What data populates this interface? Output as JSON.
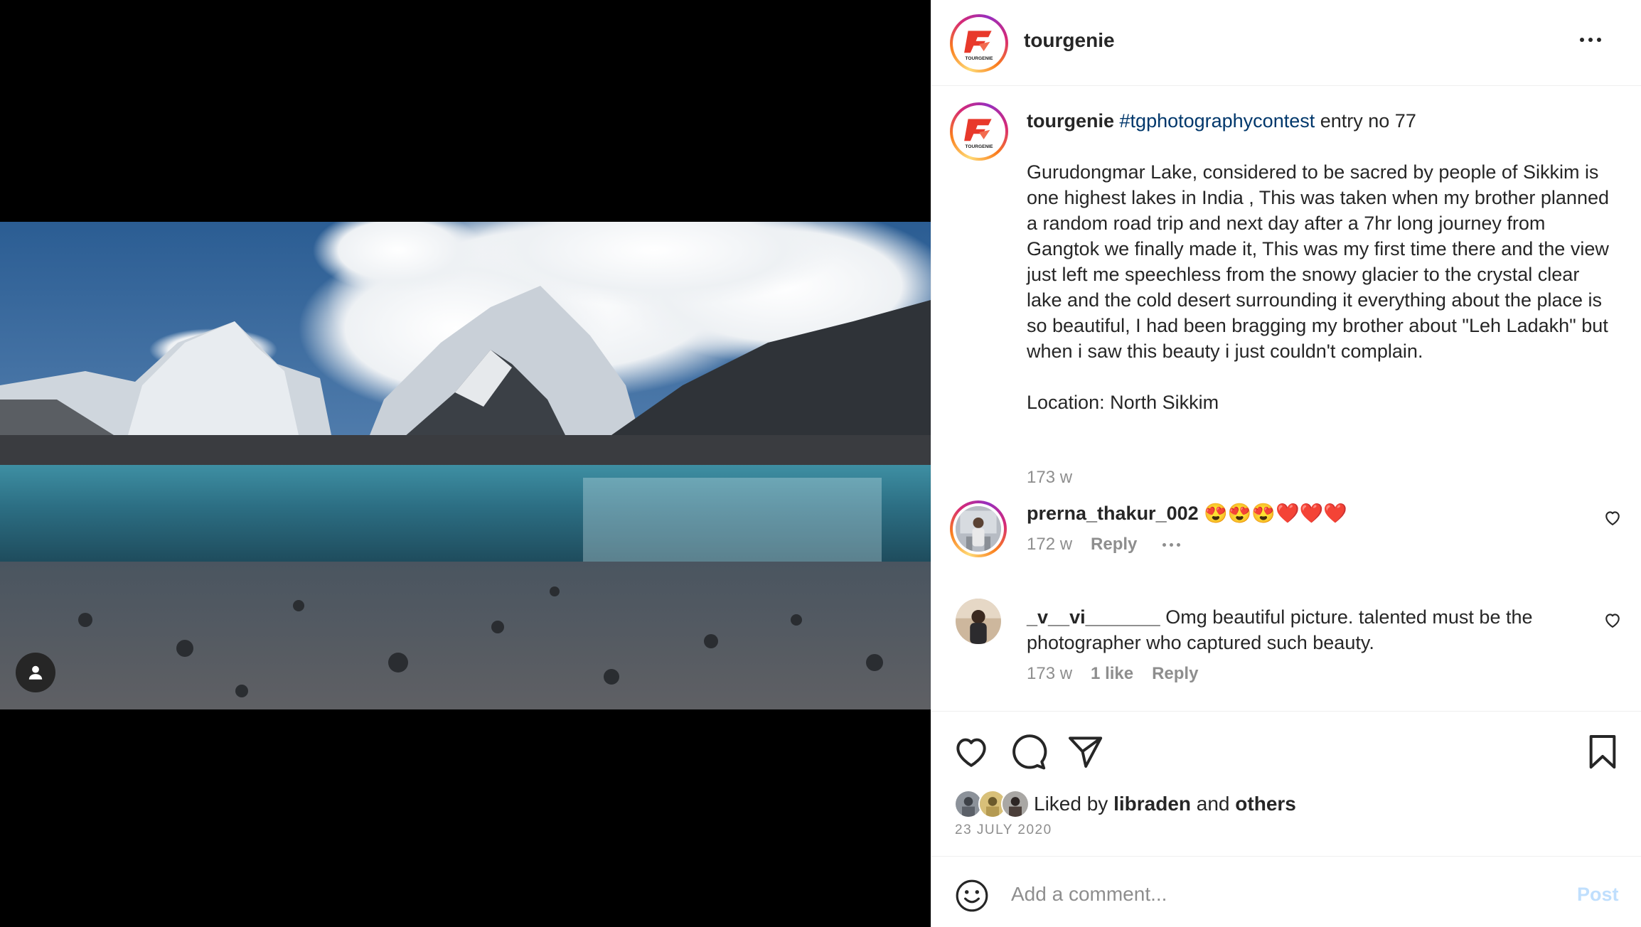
{
  "header": {
    "username": "tourgenie",
    "avatar_icon": "tourgenie-logo",
    "logo_text": "TOURGENIE",
    "more_icon": "more-horizontal-icon"
  },
  "media": {
    "image_icon": "landscape-photo",
    "tag_icon": "user-tag-icon"
  },
  "caption": {
    "username": "tourgenie",
    "hashtag": "#tgphotographycontest",
    "title_rest": " entry no 77",
    "text": "Gurudongmar Lake, considered to be sacred by people of Sikkim is one highest lakes in India , This was taken when my brother planned a random road trip and next day after a 7hr long journey from Gangtok we finally made it, This was my first time there and the view just left me speechless from the snowy glacier to the crystal clear lake and the cold desert surrounding it everything about the place is so beautiful, I had been bragging my brother about \"Leh Ladakh\" but when i saw this beauty i just couldn't complain.",
    "location": "Location: North Sikkim",
    "time": "173 w"
  },
  "comments": [
    {
      "username": "prerna_thakur_002",
      "text_emoji": "😍😍😍",
      "text_hearts": "❤️❤️❤️",
      "time": "172 w",
      "likes": "",
      "reply_label": "Reply"
    },
    {
      "username": "_v__vi_______",
      "text": " Omg beautiful picture. talented must be the photographer who captured such beauty.",
      "time": "173 w",
      "likes": "1 like",
      "reply_label": "Reply"
    }
  ],
  "actions": {
    "like_icon": "heart-icon",
    "comment_icon": "comment-icon",
    "share_icon": "send-icon",
    "save_icon": "bookmark-icon"
  },
  "likes": {
    "prefix": "Liked by ",
    "user": "libraden",
    "middle": " and ",
    "others": "others"
  },
  "date": "23 JULY 2020",
  "comment_box": {
    "placeholder": "Add a comment...",
    "post_label": "Post",
    "emoji_icon": "smiley-icon"
  },
  "colors": {
    "link": "#00376b",
    "muted": "#8e8e8e",
    "post_disabled": "#c0dffd",
    "brand_red": "#e8392b"
  }
}
